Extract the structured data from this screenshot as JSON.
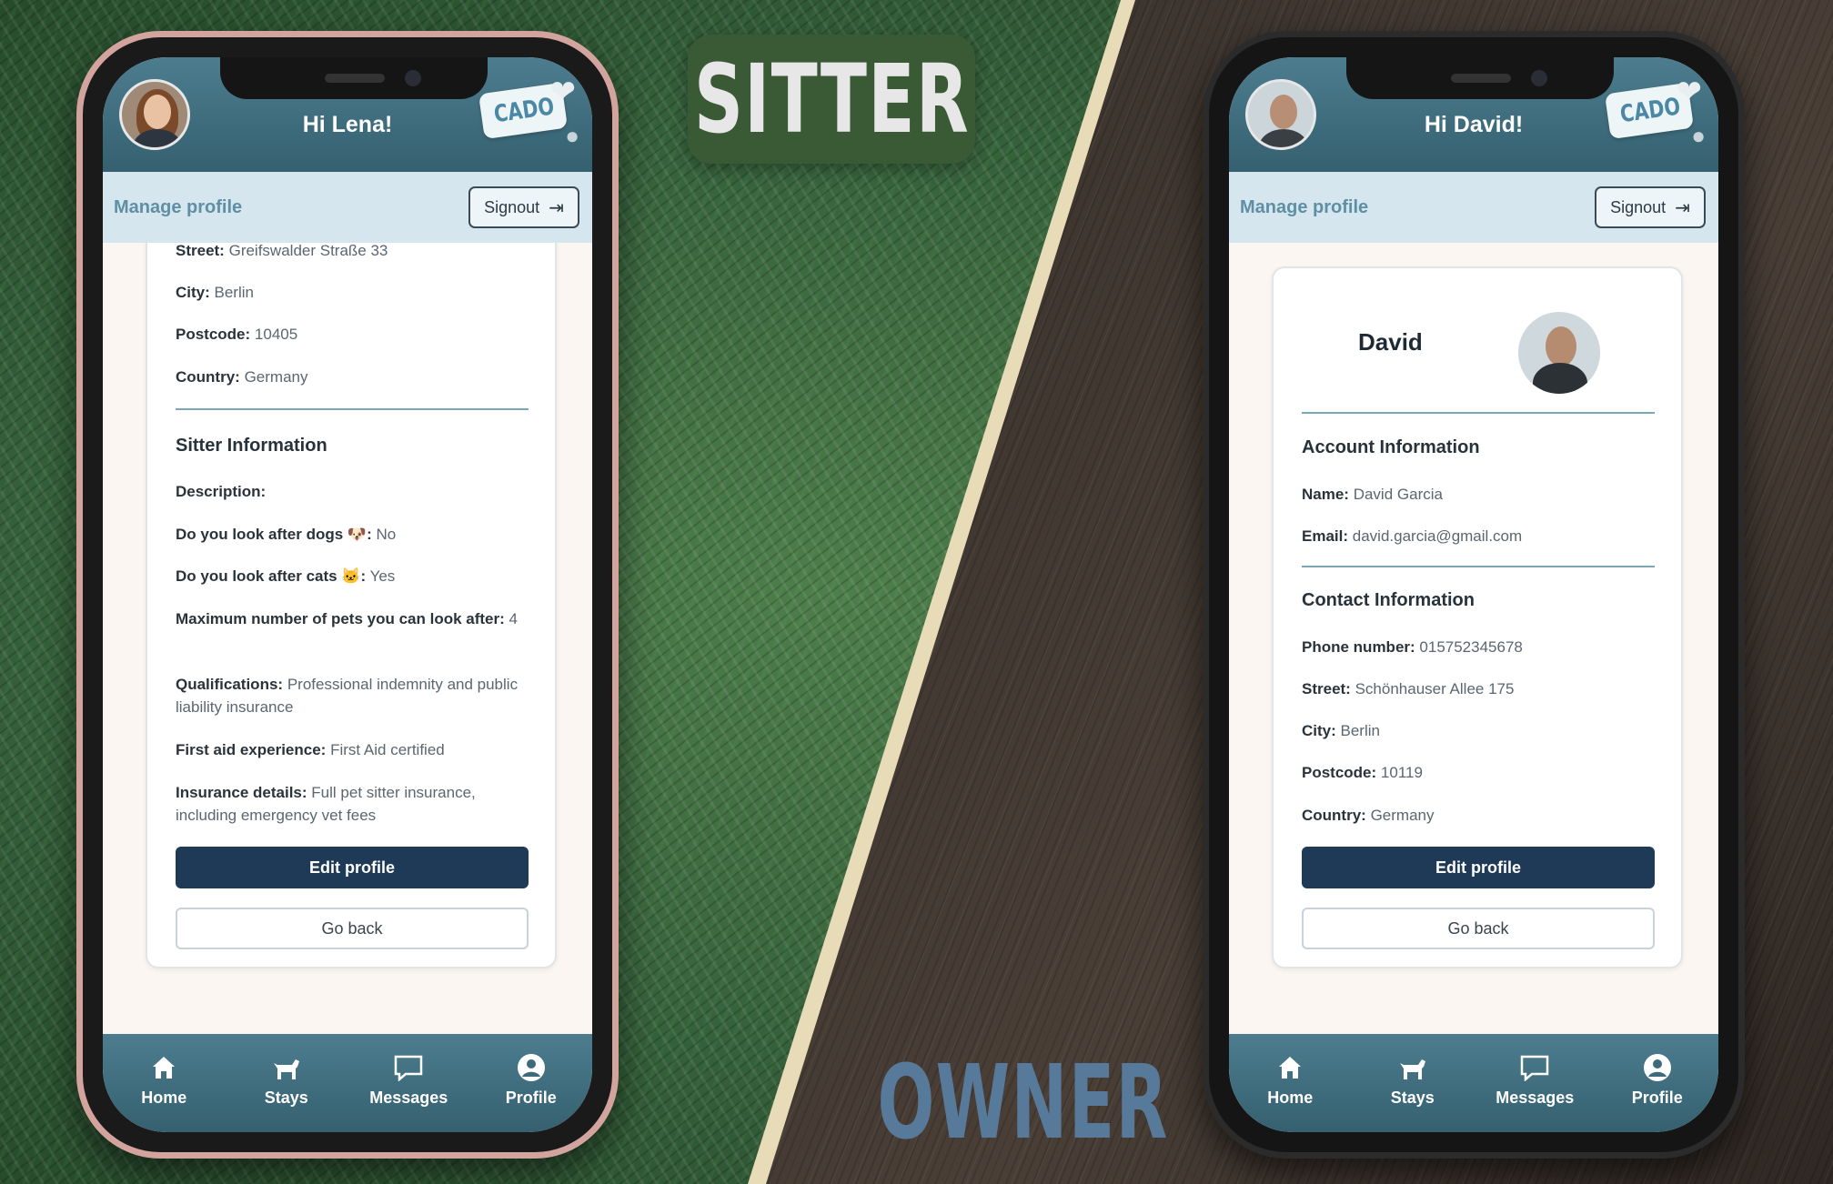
{
  "labels": {
    "sitter": "SITTER",
    "owner": "OWNER"
  },
  "brand": "CADO",
  "subbar": {
    "manage": "Manage profile",
    "signout": "Signout"
  },
  "tabs": [
    {
      "label": "Home",
      "icon": "home-icon"
    },
    {
      "label": "Stays",
      "icon": "dog-icon"
    },
    {
      "label": "Messages",
      "icon": "message-icon"
    },
    {
      "label": "Profile",
      "icon": "user-circle-icon"
    }
  ],
  "sitter": {
    "greeting": "Hi Lena!",
    "fields": [
      {
        "label": "Street:",
        "value": "Greifswalder Straße 33"
      },
      {
        "label": "City:",
        "value": "Berlin"
      },
      {
        "label": "Postcode:",
        "value": "10405"
      },
      {
        "label": "Country:",
        "value": "Germany"
      }
    ],
    "section_title": "Sitter Information",
    "sitter_fields": [
      {
        "label": "Description:",
        "value": ""
      },
      {
        "label": "Do you look after dogs 🐶:",
        "value": "No"
      },
      {
        "label": "Do you look after cats 🐱:",
        "value": "Yes"
      },
      {
        "label": "Maximum number of pets you can look after:",
        "value": "4"
      },
      {
        "label": "Qualifications:",
        "value": "Professional indemnity and public liability insurance"
      },
      {
        "label": "First aid experience:",
        "value": "First Aid certified"
      },
      {
        "label": "Insurance details:",
        "value": "Full pet sitter insurance, including emergency vet fees"
      }
    ],
    "edit_label": "Edit profile",
    "back_label": "Go back"
  },
  "owner": {
    "greeting": "Hi David!",
    "profile_name": "David",
    "account_title": "Account Information",
    "account_fields": [
      {
        "label": "Name:",
        "value": "David Garcia"
      },
      {
        "label": "Email:",
        "value": "david.garcia@gmail.com"
      }
    ],
    "contact_title": "Contact Information",
    "contact_fields": [
      {
        "label": "Phone number:",
        "value": "015752345678"
      },
      {
        "label": "Street:",
        "value": "Schönhauser Allee 175"
      },
      {
        "label": "City:",
        "value": "Berlin"
      },
      {
        "label": "Postcode:",
        "value": "10119"
      },
      {
        "label": "Country:",
        "value": "Germany"
      }
    ],
    "edit_label": "Edit profile",
    "back_label": "Go back"
  },
  "colors": {
    "header": "#3d6b7b",
    "primary_button": "#1f3a56",
    "subbar": "#d6e6ee",
    "sitter_banner": "#3a5a35",
    "owner_label": "#587a9a"
  }
}
